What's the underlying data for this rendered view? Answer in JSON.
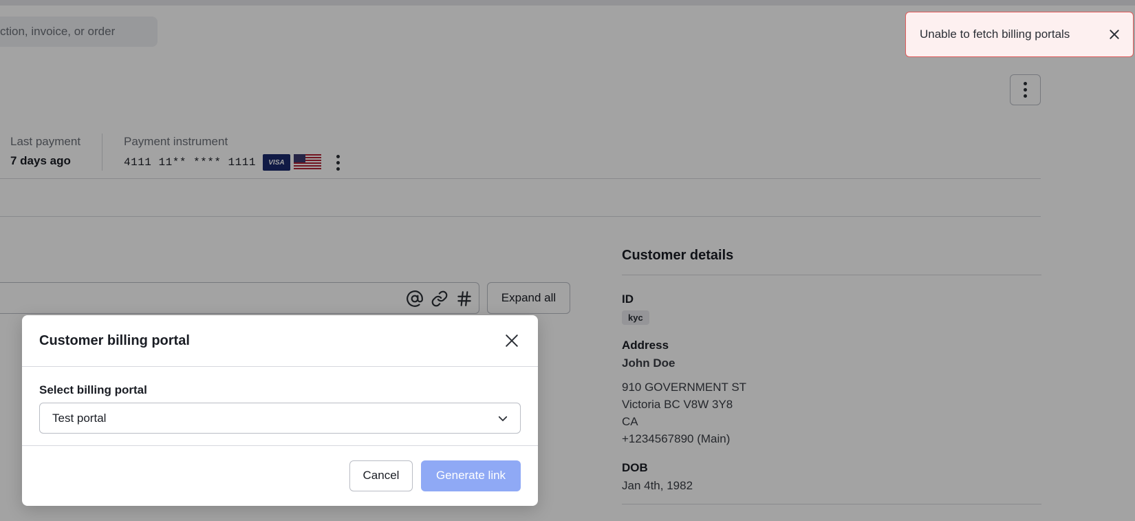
{
  "search": {
    "placeholder": "ction, invoice, or order"
  },
  "stats": {
    "last_payment": {
      "label": "Last payment",
      "value": "7 days ago"
    },
    "payment_instrument": {
      "label": "Payment instrument",
      "card_number": "4111 11** **** 1111",
      "brand": "VISA"
    }
  },
  "notes": {
    "expand_label": "Expand all"
  },
  "customer_details": {
    "title": "Customer details",
    "id_label": "ID",
    "id_value": "kyc",
    "address_label": "Address",
    "name": "John Doe",
    "address_lines": [
      "910 GOVERNMENT ST",
      "Victoria BC V8W 3Y8",
      "CA",
      "+1234567890 (Main)"
    ],
    "dob_label": "DOB",
    "dob_value": "Jan 4th, 1982"
  },
  "toast": {
    "message": "Unable to fetch billing portals",
    "color": "#e05a5a"
  },
  "modal": {
    "title": "Customer billing portal",
    "select_label": "Select billing portal",
    "selected_value": "Test portal",
    "cancel_label": "Cancel",
    "primary_label": "Generate link",
    "primary_color": "#8fa9f5"
  }
}
